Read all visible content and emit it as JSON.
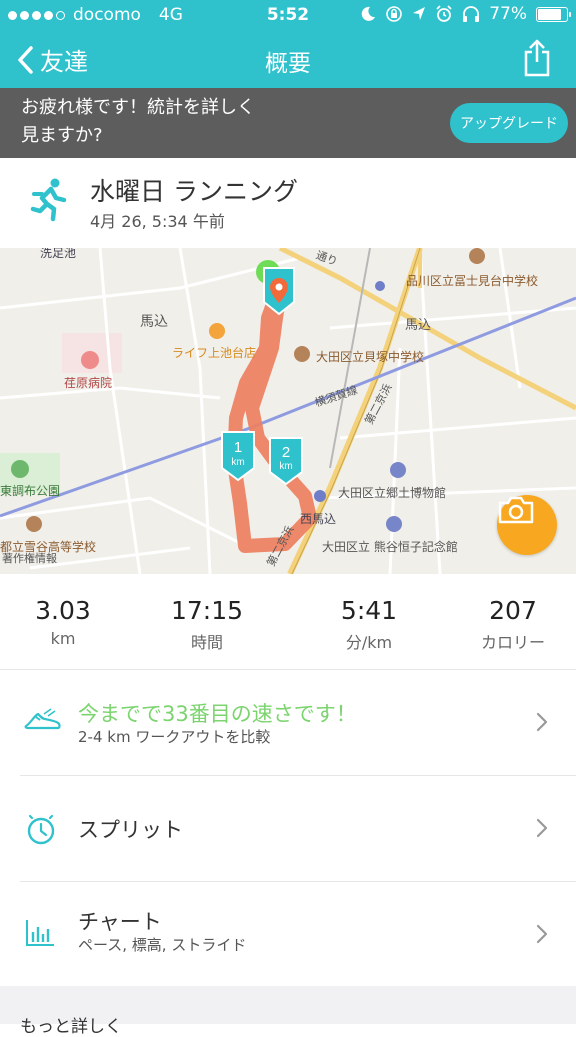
{
  "status_bar": {
    "carrier": "docomo",
    "network": "4G",
    "time": "5:52",
    "battery": "77%"
  },
  "nav": {
    "back_label": "友達",
    "title": "概要"
  },
  "banner": {
    "text": "お疲れ様です！統計を詳しく見ますか?",
    "button_label": "アップグレード"
  },
  "activity": {
    "title": "水曜日 ランニング",
    "date": "4月 26, 5:34 午前"
  },
  "map": {
    "labels": {
      "senzokuike": "洗足池",
      "magome_left": "馬込",
      "magome_right": "馬込",
      "shinagawa_school": "品川区立冨士見台中学校",
      "life_store": "ライフ上池台店",
      "kaizuka_school": "大田区立貝塚中学校",
      "ebara_hospital": "荏原病院",
      "yokosuka_line": "横須賀線",
      "daini_keihin": "第二京浜",
      "kyo_museum": "大田区立郷土博物館",
      "nishimagome": "西馬込",
      "park": "東調布公園",
      "kumagai_museum": "大田区立 熊谷恒子記念館",
      "high_school": "都立雪谷高等学校",
      "street_top": "通り",
      "daini_keihin_bottom": "第二京浜",
      "chosakusha": "著作権情報"
    },
    "markers": {
      "km1": "1",
      "km2": "2",
      "km_unit": "km"
    }
  },
  "stats": [
    {
      "value": "3.03",
      "unit": "km"
    },
    {
      "value": "17:15",
      "unit": "時間"
    },
    {
      "value": "5:41",
      "unit": "分/km"
    },
    {
      "value": "207",
      "unit": "カロリー"
    }
  ],
  "list": {
    "compare": {
      "title": "今までで33番目の速さです！",
      "subtitle": "2-4 km ワークアウトを比較"
    },
    "splits": {
      "title": "スプリット"
    },
    "chart": {
      "title": "チャート",
      "subtitle": "ペース, 標高, ストライド"
    }
  },
  "more": {
    "label": "もっと詳しく"
  },
  "colors": {
    "accent": "#2fc2cd",
    "banner_bg": "#5d5d5d",
    "route": "#ee7f60",
    "highlight_green": "#7bd46e",
    "camera": "#f7a820"
  },
  "icons": {
    "back": "chevron-left-icon",
    "share": "share-icon",
    "runner": "runner-icon",
    "camera": "camera-icon",
    "shoe": "shoe-icon",
    "splits": "stopwatch-icon",
    "chart": "bar-chart-icon",
    "chevron": "chevron-right-icon"
  }
}
